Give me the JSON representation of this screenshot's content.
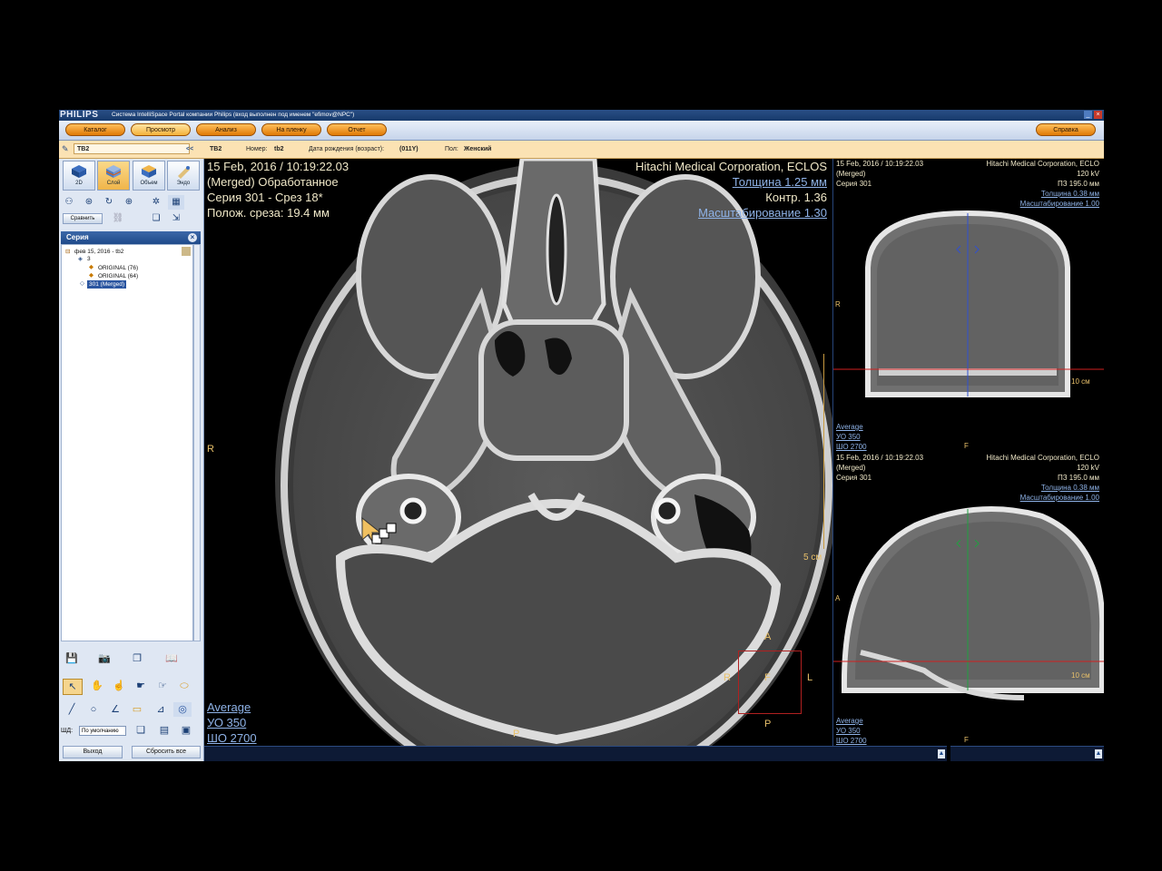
{
  "titlebar": {
    "brand": "PHILIPS",
    "title": "Система IntelliSpace Portal компании Philips (вход выполнен под именем \"efimov@NPC\")",
    "minimize": "_",
    "close": "×"
  },
  "nav": {
    "catalog": "Каталог",
    "view": "Просмотр",
    "analysis": "Анализ",
    "film": "На пленку",
    "report": "Отчет",
    "help": "Справка"
  },
  "patient": {
    "pin_icon": "pin-icon",
    "name": "TB2",
    "collapse": "<<",
    "name2": "TB2",
    "number_label": "Номер:",
    "number": "tb2",
    "dob_label": "Дата рождения (возраст):",
    "dob": "(011Y)",
    "sex_label": "Пол:",
    "sex": "Женский"
  },
  "left": {
    "modes": [
      "2D",
      "Слой",
      "Объем",
      "Эндо"
    ],
    "compare": "Сравнить",
    "series_header": "Серия",
    "tree": {
      "study": "фев 15, 2016 - tb2",
      "group": "3",
      "item1": "ORIGINAL (76)",
      "item2": "ORIGINAL (64)",
      "selected": "301 (Merged)"
    },
    "wl_label": "ШД:",
    "wl_value": "По умолчанию",
    "exit": "Выход",
    "reset": "Сбросить все"
  },
  "main": {
    "datetime": "15 Feb, 2016 / 10:19:22.03",
    "processed": "(Merged) Обработанное",
    "series": "Серия 301 - Срез 18*",
    "position": "Полож. среза: 19.4 мм",
    "manufacturer": "Hitachi Medical Corporation, ECLOS",
    "thickness": "Толщина 1.25 мм",
    "contrast": "Контр. 1.36",
    "scale": "Масштабирование 1.30",
    "ruler": "5 см",
    "mode": "Average",
    "wl": "УО   350",
    "ww": "ШО  2700",
    "orient_left": "R",
    "orient_bottom": "P",
    "cube_a": "A",
    "cube_r": "R",
    "cube_f": "F",
    "cube_l": "L",
    "cube_p": "P"
  },
  "top_right": {
    "datetime": "15 Feb, 2016 / 10:19:22.03",
    "processed": "(Merged)",
    "series": "Серия 301",
    "manufacturer": "Hitachi Medical Corporation, ECLO",
    "kv": "120 kV",
    "fov": "ПЗ 195.0 мм",
    "thickness": "Толщина 0.38 мм",
    "scale": "Масштабирование 1.00",
    "orient_left": "R",
    "orient_bottom": "F",
    "ruler": "10 см",
    "mode": "Average",
    "wl": "УО   350",
    "ww": "ШО  2700"
  },
  "bottom_right": {
    "datetime": "15 Feb, 2016 / 10:19:22.03",
    "processed": "(Merged)",
    "series": "Серия 301",
    "manufacturer": "Hitachi Medical Corporation, ECLO",
    "kv": "120 kV",
    "fov": "ПЗ 195.0 мм",
    "thickness": "Толщина 0.38 мм",
    "scale": "Масштабирование 1.00",
    "orient_left": "A",
    "orient_bottom": "F",
    "ruler": "10 см",
    "mode": "Average",
    "wl": "УО   350",
    "ww": "ШО  2700"
  },
  "colors": {
    "overlay_text": "#f0e8c8",
    "link": "#8fb3e8",
    "orientation": "#e8c06a",
    "nav_button": "#f0a020",
    "crosshair_red": "#d02020",
    "crosshair_blue": "#3050d0",
    "crosshair_green": "#20a040"
  }
}
